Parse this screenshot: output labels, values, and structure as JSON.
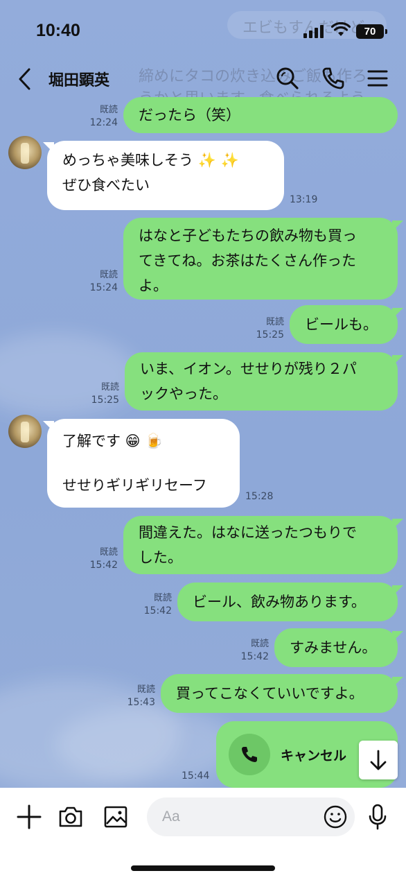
{
  "status_bar": {
    "time": "10:40",
    "battery": "70"
  },
  "header": {
    "contact_name": "堀田顕英"
  },
  "ghost_preview": {
    "line1": "エビもすんだけど",
    "line2": "締めにタコの炊き込みご飯も作ろ",
    "line3": "うかと思います。食べられるよう"
  },
  "messages": [
    {
      "direction": "out",
      "lines": [
        "だったら（笑）"
      ],
      "read": "既読",
      "time": "12:24"
    },
    {
      "direction": "in",
      "lines": [
        "めっちゃ美味しそう ✨ ✨",
        "ぜひ食べたい"
      ],
      "time": "13:19"
    },
    {
      "direction": "out",
      "lines": [
        "はなと子どもたちの飲み物も買っ",
        "てきてね。お茶はたくさん作った",
        "よ。"
      ],
      "read": "既読",
      "time": "15:24"
    },
    {
      "direction": "out",
      "lines": [
        "ビールも。"
      ],
      "read": "既読",
      "time": "15:25"
    },
    {
      "direction": "out",
      "lines": [
        "いま、イオン。せせりが残り２パ",
        "ックやった。"
      ],
      "read": "既読",
      "time": "15:25"
    },
    {
      "direction": "in",
      "lines": [
        "了解です 😁 🍺",
        "",
        "せせりギリギリセーフ"
      ],
      "time": "15:28"
    },
    {
      "direction": "out",
      "lines": [
        "間違えた。はなに送ったつもりで",
        "した。"
      ],
      "read": "既読",
      "time": "15:42"
    },
    {
      "direction": "out",
      "lines": [
        "ビール、飲み物あります。"
      ],
      "read": "既読",
      "time": "15:42"
    },
    {
      "direction": "out",
      "lines": [
        "すみません。"
      ],
      "read": "既読",
      "time": "15:42"
    },
    {
      "direction": "out",
      "lines": [
        "買ってこなくていいですよ。"
      ],
      "read": "既読",
      "time": "15:43"
    }
  ],
  "call_message": {
    "label": "キャンセル",
    "time": "15:44"
  },
  "composer": {
    "placeholder": "Aa"
  },
  "colors": {
    "bubble_out": "#86e07e",
    "bubble_in": "#ffffff",
    "chat_background": "#8fa9d9"
  },
  "icons": {
    "back": "chevron-left-icon",
    "search": "search-icon",
    "call": "phone-icon",
    "menu": "menu-icon",
    "add": "plus-icon",
    "camera": "camera-icon",
    "image": "image-icon",
    "emoji": "emoji-icon",
    "mic": "mic-icon",
    "scroll_down": "arrow-down-icon"
  }
}
